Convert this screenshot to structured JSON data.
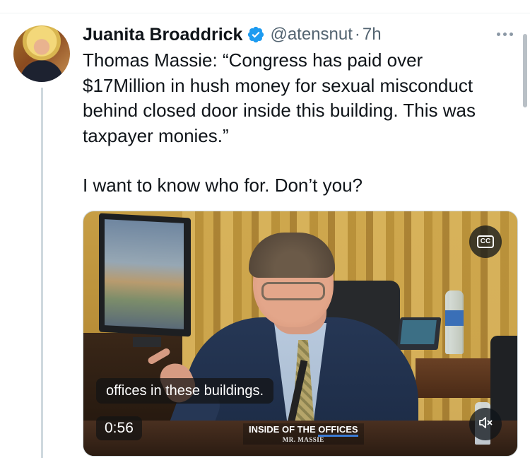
{
  "tweet": {
    "author": {
      "display_name": "Juanita Broaddrick",
      "handle": "@atensnut",
      "verified": true,
      "avatar_icon": "profile-photo"
    },
    "separator": "·",
    "time": "7h",
    "text_paragraphs": [
      "Thomas Massie:  “Congress has paid over $17Million in hush money for sexual misconduct behind closed door inside this building.  This was taxpayer monies.”",
      "I want to know who for.   Don’t you?"
    ]
  },
  "video": {
    "caption": "offices in these buildings.",
    "duration": "0:56",
    "lower_third": {
      "line1_prefix": "INSIDE OF THE ",
      "line1_accent": "OFFICES",
      "line2": "MR. MASSIE"
    },
    "cc_label": "CC",
    "mute_icon": "speaker-muted-icon"
  },
  "colors": {
    "text": "#0f1419",
    "secondary_text": "#536471",
    "verified_blue": "#1d9bf0",
    "thread_line": "#cfd9de"
  }
}
